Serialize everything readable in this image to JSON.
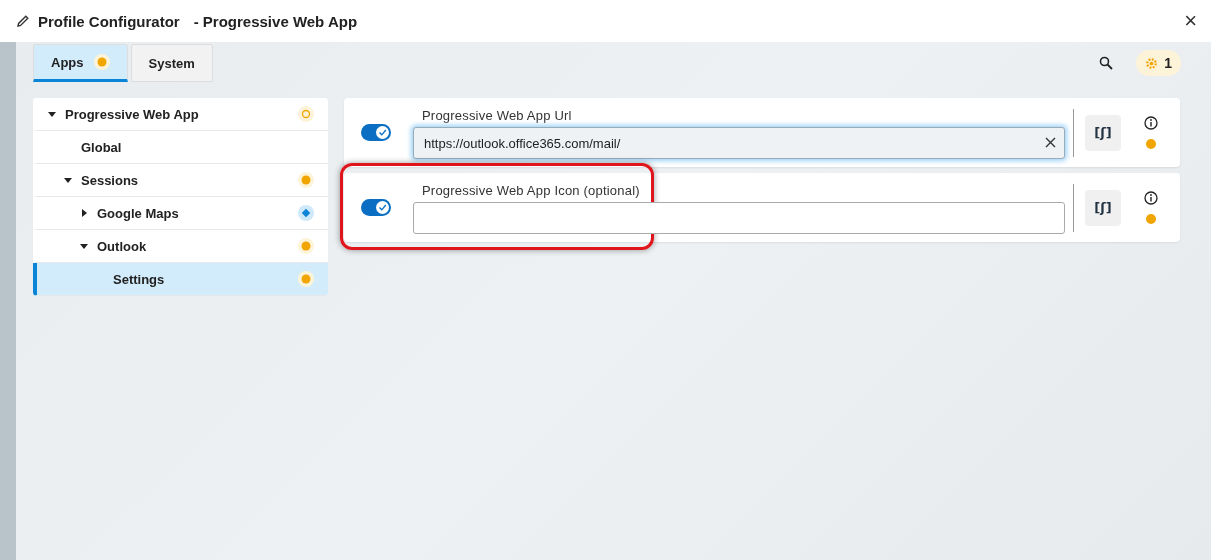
{
  "window": {
    "title": "Profile Configurator",
    "subtitle": "- Progressive Web App",
    "close": "×"
  },
  "tabs": [
    {
      "label": "Apps",
      "selected": true,
      "status": {
        "kind": "dot"
      }
    },
    {
      "label": "System",
      "selected": false
    }
  ],
  "notifications": {
    "count": "1"
  },
  "tree": [
    {
      "label": "Progressive Web App",
      "expanded": true,
      "selected": false,
      "status": {
        "kind": "ring"
      },
      "children": [
        {
          "label": "Global",
          "selected": false
        },
        {
          "label": "Sessions",
          "expanded": true,
          "selected": false,
          "status": {
            "kind": "dot"
          },
          "children": [
            {
              "label": "Google Maps",
              "expanded": false,
              "selected": false,
              "status": {
                "kind": "diamond"
              }
            },
            {
              "label": "Outlook",
              "expanded": true,
              "selected": false,
              "status": {
                "kind": "dot"
              },
              "children": [
                {
                  "label": "Settings",
                  "selected": true,
                  "status": {
                    "kind": "dot"
                  }
                }
              ]
            }
          ]
        }
      ]
    }
  ],
  "fields": [
    {
      "label": "Progressive Web App Url",
      "enabled": true,
      "value": "https://outlook.office365.com/mail/",
      "focused": true,
      "highlighted": false,
      "script_button": "[ʃ]",
      "status": {
        "kind": "dot"
      }
    },
    {
      "label": "Progressive Web App Icon (optional)",
      "enabled": true,
      "focused": false,
      "highlighted": true,
      "script_button": "[ʃ]",
      "status": {
        "kind": "dot"
      }
    }
  ]
}
